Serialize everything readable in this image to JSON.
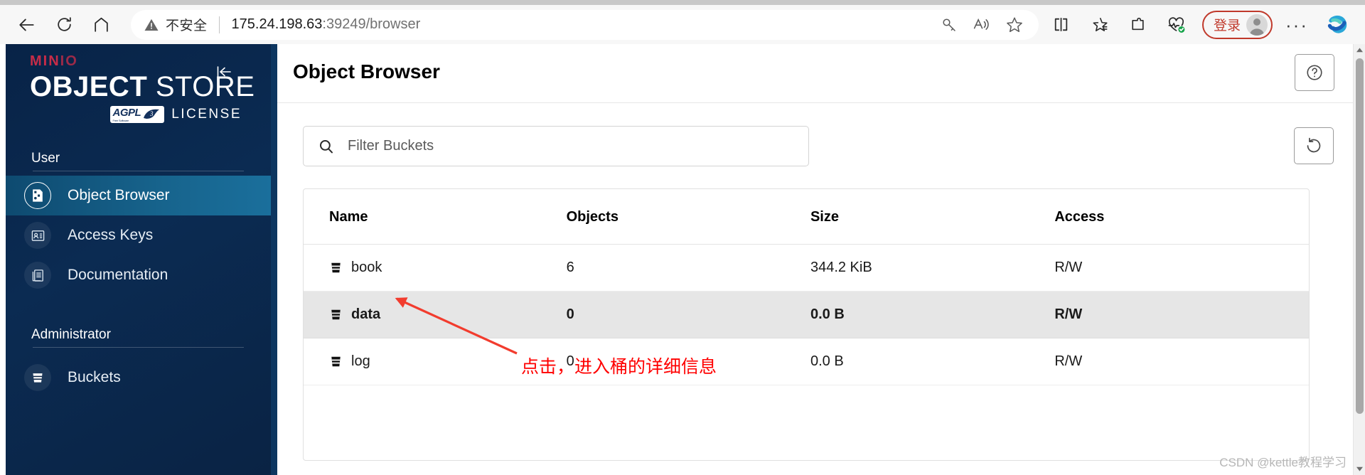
{
  "browser": {
    "back_icon": "arrow-left-icon",
    "reload_icon": "reload-icon",
    "home_icon": "home-icon",
    "security_label": "不安全",
    "url_host": "175.24.198.63",
    "url_path": ":39249/browser",
    "omnibox_icons": [
      "key-icon",
      "read-aloud-icon",
      "favorite-star-icon"
    ],
    "toolbar_icons": [
      "split-screen-icon",
      "collections-icon",
      "extensions-icon",
      "browser-essentials-icon"
    ],
    "signin_label": "登录",
    "settings_more_label": "···",
    "copilot_icon": "copilot-icon",
    "accent_red": "#c0392b"
  },
  "sidebar": {
    "logo": {
      "brand_first": "MIN",
      "brand_second": "IO",
      "product_bold": "OBJECT",
      "product_light": " STORE",
      "license_badge": "AGPL",
      "license_badge_sub": "Free Software",
      "license_word": "LICENSE",
      "brand_color": "#c72c48"
    },
    "collapse_icon": "collapse-sidebar-icon",
    "sections": [
      {
        "title": "User",
        "items": [
          {
            "label": "Object Browser",
            "icon": "object-browser-icon",
            "active": true
          },
          {
            "label": "Access Keys",
            "icon": "access-keys-icon",
            "active": false
          },
          {
            "label": "Documentation",
            "icon": "documentation-icon",
            "active": false
          }
        ]
      },
      {
        "title": "Administrator",
        "items": [
          {
            "label": "Buckets",
            "icon": "bucket-icon",
            "active": false
          }
        ]
      }
    ]
  },
  "main": {
    "page_title": "Object Browser",
    "help_icon": "help-circle-icon",
    "refresh_icon": "refresh-icon",
    "filter": {
      "placeholder": "Filter Buckets",
      "value": "",
      "icon": "search-icon"
    },
    "table": {
      "columns": [
        "Name",
        "Objects",
        "Size",
        "Access"
      ],
      "rows": [
        {
          "name": "book",
          "objects": "6",
          "size": "344.2 KiB",
          "access": "R/W",
          "highlighted": false
        },
        {
          "name": "data",
          "objects": "0",
          "size": "0.0 B",
          "access": "R/W",
          "highlighted": true
        },
        {
          "name": "log",
          "objects": "0",
          "size": "0.0 B",
          "access": "R/W",
          "highlighted": false
        }
      ]
    }
  },
  "annotation": {
    "text": "点击，进入桶的详细信息",
    "color": "#ff0000",
    "arrow_icon": "red-arrow-icon"
  },
  "watermark": "CSDN @kettle教程学习",
  "scrollbar": {
    "up_icon": "scroll-up-icon",
    "down_icon": "scroll-down-icon"
  }
}
